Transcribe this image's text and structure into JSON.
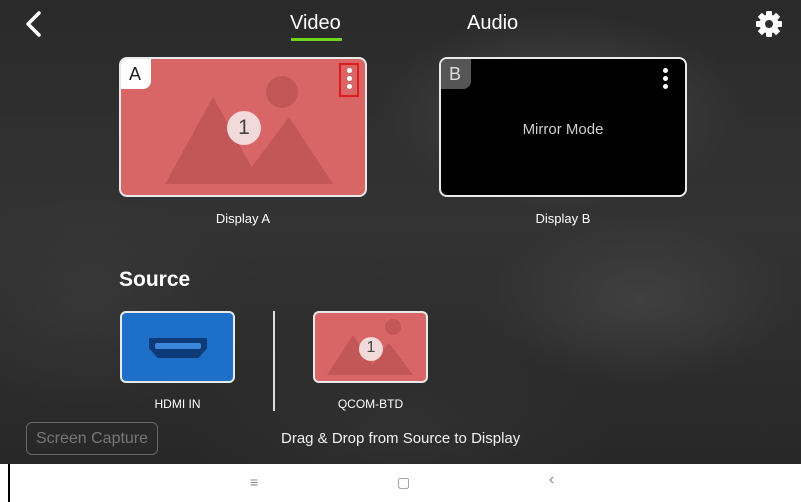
{
  "tabs": {
    "video": "Video",
    "audio": "Audio"
  },
  "displays": [
    {
      "corner": "A",
      "label": "Display A",
      "content_badge": "1"
    },
    {
      "corner": "B",
      "label": "Display B",
      "status": "Mirror Mode"
    }
  ],
  "source": {
    "title": "Source",
    "items": [
      {
        "label": "HDMI IN",
        "icon": "hdmi-icon"
      },
      {
        "label": "QCOM-BTD",
        "badge": "1",
        "icon": "image-icon"
      }
    ]
  },
  "footer": {
    "screen_capture": "Screen Capture",
    "hint": "Drag & Drop from Source to Display"
  },
  "navbar": {
    "menu": "≡",
    "home": "▢",
    "back": "‹"
  },
  "colors": {
    "accent": "#6fd619",
    "display_a": "#d96666",
    "hdmi": "#1e6fc7",
    "highlight": "#e01b1b"
  }
}
